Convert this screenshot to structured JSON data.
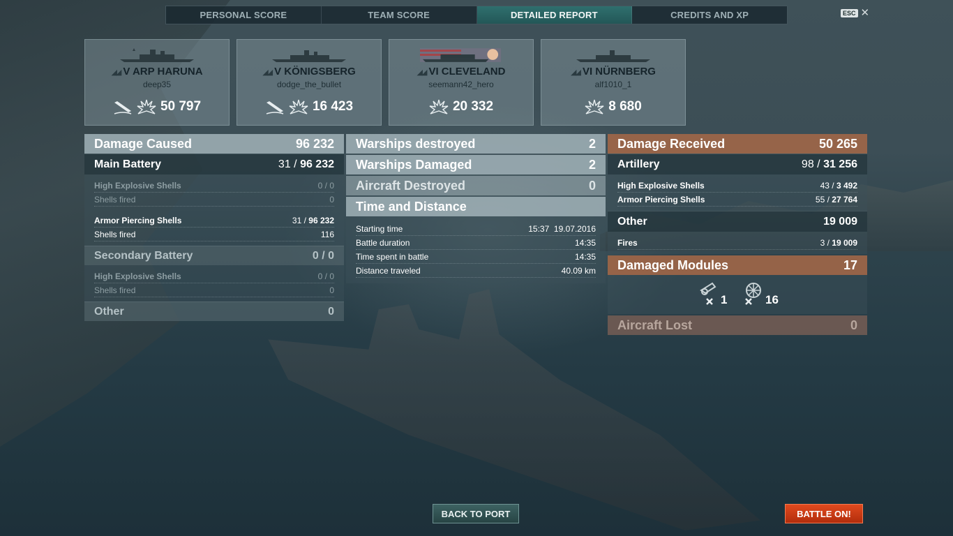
{
  "tabs": [
    {
      "label": "PERSONAL SCORE"
    },
    {
      "label": "TEAM SCORE"
    },
    {
      "label": "DETAILED REPORT",
      "active": true
    },
    {
      "label": "CREDITS AND XP"
    }
  ],
  "esc_label": "ESC",
  "ships": [
    {
      "tier_name": "V ARP HARUNA",
      "player": "deep35",
      "sunk": true,
      "damage": "50 797"
    },
    {
      "tier_name": "V KÖNIGSBERG",
      "player": "dodge_the_bullet",
      "sunk": true,
      "damage": "16 423"
    },
    {
      "tier_name": "VI CLEVELAND",
      "player": "seemann42_hero",
      "sunk": false,
      "damage": "20 332"
    },
    {
      "tier_name": "VI NÜRNBERG",
      "player": "alf1010_1",
      "sunk": false,
      "damage": "8 680"
    }
  ],
  "damage_caused": {
    "title": "Damage Caused",
    "total": "96 232",
    "main_battery": {
      "label": "Main Battery",
      "hits": "31",
      "damage": "96 232"
    },
    "mb_he": {
      "label": "High Explosive Shells",
      "hits": "0",
      "damage": "0"
    },
    "mb_he_fired": {
      "label": "Shells fired",
      "value": "0"
    },
    "mb_ap": {
      "label": "Armor Piercing Shells",
      "hits": "31",
      "damage": "96 232"
    },
    "mb_ap_fired": {
      "label": "Shells fired",
      "value": "116"
    },
    "secondary": {
      "label": "Secondary Battery",
      "hits": "0",
      "damage": "0"
    },
    "sec_he": {
      "label": "High Explosive Shells",
      "hits": "0",
      "damage": "0"
    },
    "sec_he_fired": {
      "label": "Shells fired",
      "value": "0"
    },
    "other": {
      "label": "Other",
      "value": "0"
    }
  },
  "center": {
    "destroyed": {
      "label": "Warships destroyed",
      "value": "2"
    },
    "damaged": {
      "label": "Warships Damaged",
      "value": "2"
    },
    "aircraft": {
      "label": "Aircraft Destroyed",
      "value": "0"
    },
    "time_title": "Time and Distance",
    "start": {
      "label": "Starting time",
      "value": "15:37  19.07.2016"
    },
    "duration": {
      "label": "Battle duration",
      "value": "14:35"
    },
    "spent": {
      "label": "Time spent in battle",
      "value": "14:35"
    },
    "distance": {
      "label": "Distance traveled",
      "value": "40.09 km"
    }
  },
  "damage_received": {
    "title": "Damage Received",
    "total": "50 265",
    "artillery": {
      "label": "Artillery",
      "hits": "98",
      "damage": "31 256"
    },
    "he": {
      "label": "High Explosive Shells",
      "hits": "43",
      "damage": "3 492"
    },
    "ap": {
      "label": "Armor Piercing Shells",
      "hits": "55",
      "damage": "27 764"
    },
    "other": {
      "label": "Other",
      "value": "19 009"
    },
    "fires": {
      "label": "Fires",
      "hits": "3",
      "damage": "19 009"
    },
    "modules": {
      "label": "Damaged Modules",
      "value": "17",
      "guns": "1",
      "steering": "16"
    },
    "aircraft_lost": {
      "label": "Aircraft Lost",
      "value": "0"
    }
  },
  "buttons": {
    "back": "BACK TO PORT",
    "battle": "BATTLE ON!"
  },
  "colors": {
    "accent_teal": "#2f6f6e",
    "damage_received": "#9e6648",
    "battle_button": "#e14a1e"
  }
}
